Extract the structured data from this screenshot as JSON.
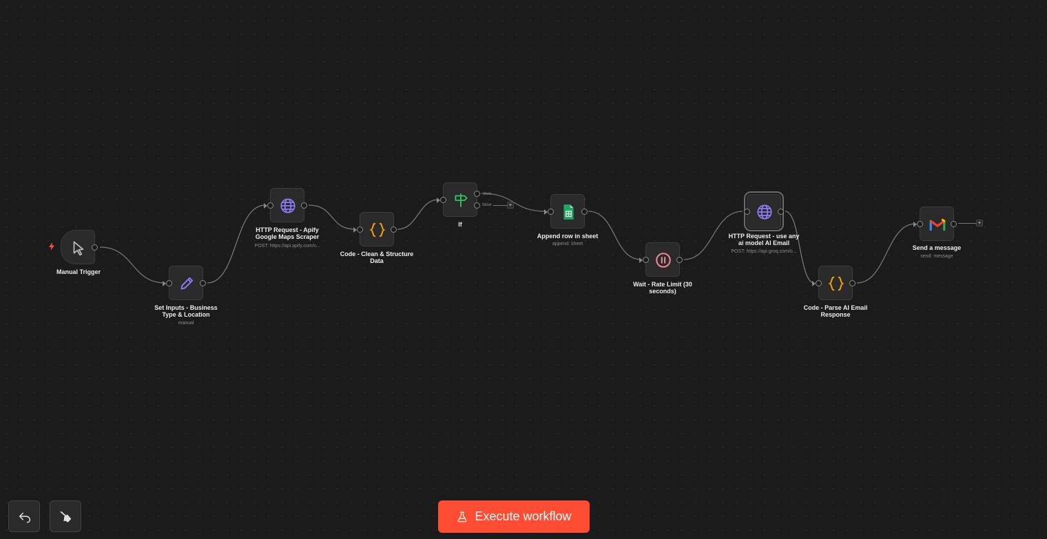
{
  "nodes": [
    {
      "id": "manual-trigger",
      "label": "Manual Trigger",
      "subtitle": ""
    },
    {
      "id": "set-inputs",
      "label": "Set Inputs - Business Type & Location",
      "subtitle": "manual"
    },
    {
      "id": "http-apify",
      "label": "HTTP Request - Apify Google Maps Scraper",
      "subtitle": "POST: https://api.apify.com/v..."
    },
    {
      "id": "code-clean",
      "label": "Code - Clean & Structure Data",
      "subtitle": ""
    },
    {
      "id": "if",
      "label": "If",
      "subtitle": ""
    },
    {
      "id": "append-row",
      "label": "Append row in sheet",
      "subtitle": "append: sheet"
    },
    {
      "id": "wait",
      "label": "Wait - Rate Limit (30 seconds)",
      "subtitle": ""
    },
    {
      "id": "http-ai",
      "label": "HTTP Request - use any ai model AI Email",
      "subtitle": "POST: https://api.groq.com/o..."
    },
    {
      "id": "code-parse",
      "label": "Code - Parse AI Email Response",
      "subtitle": ""
    },
    {
      "id": "send-message",
      "label": "Send a message",
      "subtitle": "send: message"
    }
  ],
  "branches": {
    "true_label": "true",
    "false_label": "false"
  },
  "plus_symbol": "+",
  "toolbar": {
    "execute_label": "Execute workflow"
  },
  "colors": {
    "accent": "#ff4d33",
    "http_icon": "#8b7cf6",
    "code_icon": "#f59e0b",
    "if_icon": "#35c46a",
    "sheets_icon": "#23a566",
    "wait_icon": "#f08a94",
    "trigger_bolt": "#ff4d4d"
  },
  "icons": [
    "cursor-icon",
    "pencil-icon",
    "globe-icon",
    "braces-icon",
    "signpost-icon",
    "sheets-icon",
    "pause-icon",
    "gmail-icon",
    "bolt-icon",
    "undo-icon",
    "broom-icon",
    "flask-icon"
  ]
}
